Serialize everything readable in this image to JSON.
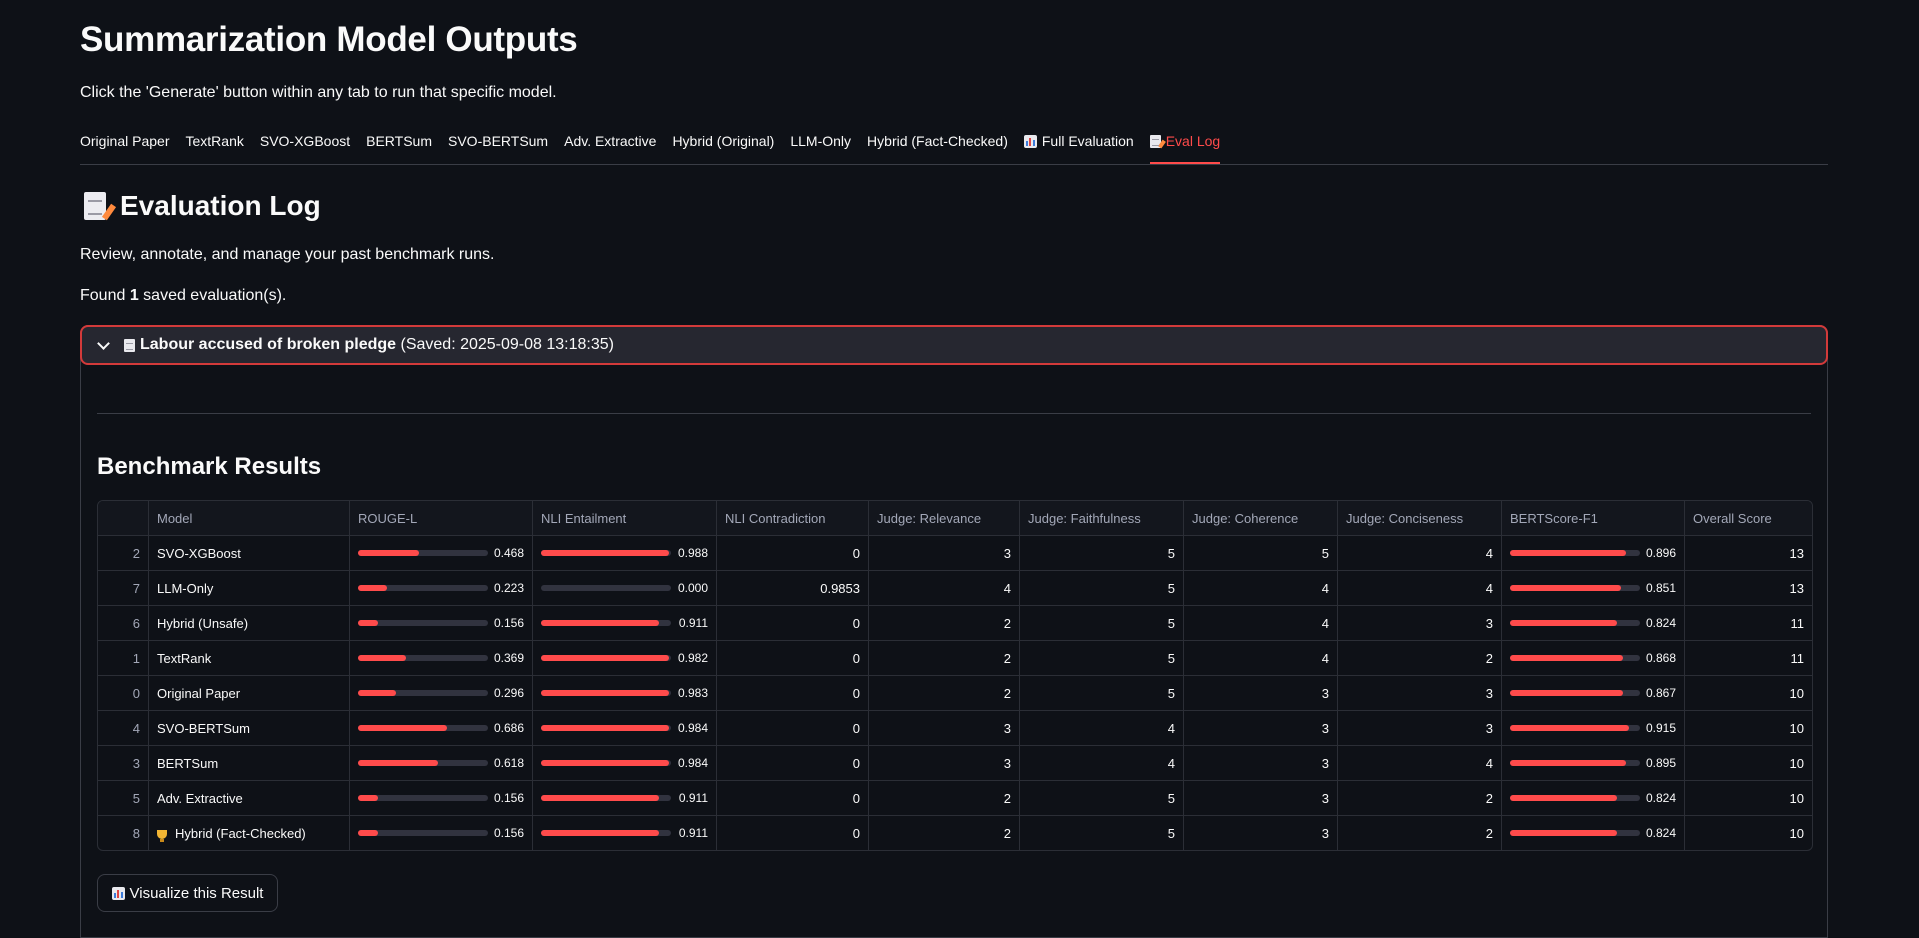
{
  "page": {
    "title": "Summarization Model Outputs",
    "subtitle": "Click the 'Generate' button within any tab to run that specific model."
  },
  "tabs": [
    {
      "label": "Original Paper",
      "icon": null,
      "active": false
    },
    {
      "label": "TextRank",
      "icon": null,
      "active": false
    },
    {
      "label": "SVO-XGBoost",
      "icon": null,
      "active": false
    },
    {
      "label": "BERTSum",
      "icon": null,
      "active": false
    },
    {
      "label": "SVO-BERTSum",
      "icon": null,
      "active": false
    },
    {
      "label": "Adv. Extractive",
      "icon": null,
      "active": false
    },
    {
      "label": "Hybrid (Original)",
      "icon": null,
      "active": false
    },
    {
      "label": "LLM-Only",
      "icon": null,
      "active": false
    },
    {
      "label": "Hybrid (Fact-Checked)",
      "icon": null,
      "active": false
    },
    {
      "label": "Full Evaluation",
      "icon": "bar-chart-icon",
      "active": false
    },
    {
      "label": "Eval Log",
      "icon": "memo-icon",
      "active": true
    }
  ],
  "section": {
    "title": "Evaluation Log",
    "description": "Review, annotate, and manage your past benchmark runs.",
    "found_prefix": "Found ",
    "found_count": "1",
    "found_suffix": " saved evaluation(s)."
  },
  "expander": {
    "title": "Labour accused of broken pledge",
    "saved": " (Saved: 2025-09-08 13:18:35)",
    "benchmark_title": "Benchmark Results"
  },
  "table": {
    "headers": [
      "",
      "Model",
      "ROUGE-L",
      "NLI Entailment",
      "NLI Contradiction",
      "Judge: Relevance",
      "Judge: Faithfulness",
      "Judge: Coherence",
      "Judge: Conciseness",
      "BERTScore-F1",
      "Overall Score"
    ],
    "rows": [
      {
        "idx": "2",
        "model": "SVO-XGBoost",
        "trophy": false,
        "rouge": "0.468",
        "nli_ent": "0.988",
        "nli_con": "0",
        "relevance": "3",
        "faithfulness": "5",
        "coherence": "5",
        "conciseness": "4",
        "bertscore": "0.896",
        "overall": "13"
      },
      {
        "idx": "7",
        "model": "LLM-Only",
        "trophy": false,
        "rouge": "0.223",
        "nli_ent": "0.000",
        "nli_con": "0.9853",
        "relevance": "4",
        "faithfulness": "5",
        "coherence": "4",
        "conciseness": "4",
        "bertscore": "0.851",
        "overall": "13"
      },
      {
        "idx": "6",
        "model": "Hybrid (Unsafe)",
        "trophy": false,
        "rouge": "0.156",
        "nli_ent": "0.911",
        "nli_con": "0",
        "relevance": "2",
        "faithfulness": "5",
        "coherence": "4",
        "conciseness": "3",
        "bertscore": "0.824",
        "overall": "11"
      },
      {
        "idx": "1",
        "model": "TextRank",
        "trophy": false,
        "rouge": "0.369",
        "nli_ent": "0.982",
        "nli_con": "0",
        "relevance": "2",
        "faithfulness": "5",
        "coherence": "4",
        "conciseness": "2",
        "bertscore": "0.868",
        "overall": "11"
      },
      {
        "idx": "0",
        "model": "Original Paper",
        "trophy": false,
        "rouge": "0.296",
        "nli_ent": "0.983",
        "nli_con": "0",
        "relevance": "2",
        "faithfulness": "5",
        "coherence": "3",
        "conciseness": "3",
        "bertscore": "0.867",
        "overall": "10"
      },
      {
        "idx": "4",
        "model": "SVO-BERTSum",
        "trophy": false,
        "rouge": "0.686",
        "nli_ent": "0.984",
        "nli_con": "0",
        "relevance": "3",
        "faithfulness": "4",
        "coherence": "3",
        "conciseness": "3",
        "bertscore": "0.915",
        "overall": "10"
      },
      {
        "idx": "3",
        "model": "BERTSum",
        "trophy": false,
        "rouge": "0.618",
        "nli_ent": "0.984",
        "nli_con": "0",
        "relevance": "3",
        "faithfulness": "4",
        "coherence": "3",
        "conciseness": "4",
        "bertscore": "0.895",
        "overall": "10"
      },
      {
        "idx": "5",
        "model": "Adv. Extractive",
        "trophy": false,
        "rouge": "0.156",
        "nli_ent": "0.911",
        "nli_con": "0",
        "relevance": "2",
        "faithfulness": "5",
        "coherence": "3",
        "conciseness": "2",
        "bertscore": "0.824",
        "overall": "10"
      },
      {
        "idx": "8",
        "model": "Hybrid (Fact-Checked)",
        "trophy": true,
        "rouge": "0.156",
        "nli_ent": "0.911",
        "nli_con": "0",
        "relevance": "2",
        "faithfulness": "5",
        "coherence": "3",
        "conciseness": "2",
        "bertscore": "0.824",
        "overall": "10"
      }
    ]
  },
  "visualize_button": "Visualize this Result",
  "colors": {
    "accent": "#ff4b4b",
    "background": "#0e1117",
    "header_bg": "#262730",
    "border": "#3a3d46"
  }
}
